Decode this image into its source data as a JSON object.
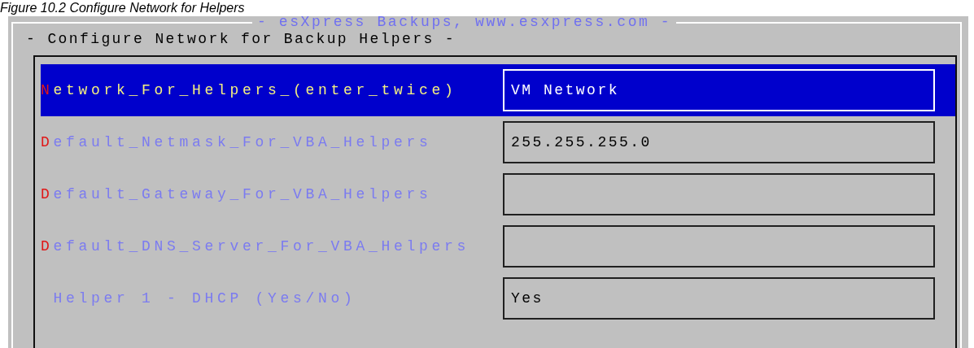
{
  "caption": "Figure 10.2 Configure Network for Helpers",
  "window": {
    "title": "- esXpress Backups, www.esxpress.com -",
    "subtitle": "- Configure Network for Backup Helpers -"
  },
  "fields": [
    {
      "label": "Network_For_Helpers_(enter_twice)",
      "hotkey": true,
      "value": "VM Network",
      "selected": true
    },
    {
      "label": "Default_Netmask_For_VBA_Helpers",
      "hotkey": true,
      "value": "255.255.255.0",
      "selected": false
    },
    {
      "label": "Default_Gateway_For_VBA_Helpers",
      "hotkey": true,
      "selected": false
    },
    {
      "label": "Default_DNS_Server_For_VBA_Helpers",
      "hotkey": true,
      "selected": false
    },
    {
      "label": " Helper 1 - DHCP (Yes/No)",
      "hotkey": false,
      "value": "Yes",
      "selected": false
    }
  ]
}
